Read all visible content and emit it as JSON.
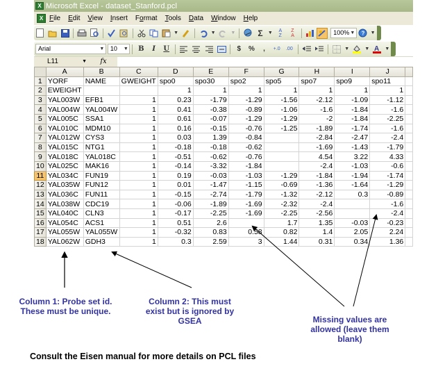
{
  "window": {
    "title": "Microsoft Excel - dataset_Stanford.pcl"
  },
  "menu": {
    "items": [
      "File",
      "Edit",
      "View",
      "Insert",
      "Format",
      "Tools",
      "Data",
      "Window",
      "Help"
    ],
    "mnemonics": [
      "F",
      "E",
      "V",
      "I",
      "o",
      "T",
      "D",
      "W",
      "H"
    ]
  },
  "toolbar": {
    "standard_icons": [
      "new-icon",
      "open-icon",
      "save-icon",
      "print-icon",
      "print-preview-icon",
      "spelling-icon",
      "research-icon",
      "cut-icon",
      "copy-icon",
      "paste-icon",
      "format-painter-icon",
      "undo-icon",
      "redo-icon",
      "hyperlink-icon",
      "autosum-icon",
      "sort-ascending-icon",
      "sort-descending-icon",
      "chart-wizard-icon",
      "drawing-icon",
      "help-icon"
    ],
    "zoom": "100%",
    "font_name": "Arial",
    "font_size": "10",
    "bold_label": "B",
    "italic_label": "I",
    "underline_label": "U",
    "currency_label": "$",
    "percent_label": "%",
    "comma_label": ",",
    "increase_decimal_label": "+.0",
    "decrease_decimal_label": ".00",
    "autosum_label": "Σ",
    "font_color": "#e00000",
    "fill_color": "#ffff00"
  },
  "formula_bar": {
    "name_box": "L11",
    "fx_label": "fx",
    "formula": ""
  },
  "sheet": {
    "columns": [
      "A",
      "B",
      "C",
      "D",
      "E",
      "F",
      "G",
      "H",
      "I",
      "J",
      ""
    ],
    "active_row": 11,
    "rows": [
      {
        "n": "1",
        "cells": [
          "YORF",
          "NAME",
          "GWEIGHT",
          "spo0",
          "spo30",
          "spo2",
          "spo5",
          "spo7",
          "spo9",
          "spo11"
        ]
      },
      {
        "n": "2",
        "cells": [
          "EWEIGHT",
          "",
          "",
          "1",
          "1",
          "1",
          "1",
          "1",
          "1",
          "1"
        ]
      },
      {
        "n": "3",
        "cells": [
          "YAL003W",
          "EFB1",
          "1",
          "0.23",
          "-1.79",
          "-1.29",
          "-1.56",
          "-2.12",
          "-1.09",
          "-1.12"
        ]
      },
      {
        "n": "4",
        "cells": [
          "YAL004W",
          "YAL004W",
          "1",
          "0.41",
          "-0.38",
          "-0.89",
          "-1.06",
          "-1.6",
          "-1.84",
          "-1.6"
        ]
      },
      {
        "n": "5",
        "cells": [
          "YAL005C",
          "SSA1",
          "1",
          "0.61",
          "-0.07",
          "-1.29",
          "-1.29",
          "-2",
          "-1.84",
          "-2.25"
        ]
      },
      {
        "n": "6",
        "cells": [
          "YAL010C",
          "MDM10",
          "1",
          "0.16",
          "-0.15",
          "-0.76",
          "-1.25",
          "-1.89",
          "-1.74",
          "-1.6"
        ]
      },
      {
        "n": "7",
        "cells": [
          "YAL012W",
          "CYS3",
          "1",
          "0.03",
          "1.39",
          "-0.84",
          "",
          "-2.84",
          "-2.47",
          "-2.4"
        ]
      },
      {
        "n": "8",
        "cells": [
          "YAL015C",
          "NTG1",
          "1",
          "-0.18",
          "-0.18",
          "-0.62",
          "",
          "-1.69",
          "-1.43",
          "-1.79"
        ]
      },
      {
        "n": "9",
        "cells": [
          "YAL018C",
          "YAL018C",
          "1",
          "-0.51",
          "-0.62",
          "-0.76",
          "",
          "4.54",
          "3.22",
          "4.33"
        ]
      },
      {
        "n": "10",
        "cells": [
          "YAL025C",
          "MAK16",
          "1",
          "-0.14",
          "-3.32",
          "-1.84",
          "",
          "-2.4",
          "-1.03",
          "-0.6"
        ]
      },
      {
        "n": "11",
        "cells": [
          "YAL034C",
          "FUN19",
          "1",
          "0.19",
          "-0.03",
          "-1.03",
          "-1.29",
          "-1.84",
          "-1.94",
          "-1.74"
        ]
      },
      {
        "n": "12",
        "cells": [
          "YAL035W",
          "FUN12",
          "1",
          "0.01",
          "-1.47",
          "-1.15",
          "-0.69",
          "-1.36",
          "-1.64",
          "-1.29"
        ]
      },
      {
        "n": "13",
        "cells": [
          "YAL036C",
          "FUN11",
          "1",
          "-0.15",
          "-2.74",
          "-1.79",
          "-1.32",
          "-2.12",
          "0.3",
          "-0.89"
        ]
      },
      {
        "n": "14",
        "cells": [
          "YAL038W",
          "CDC19",
          "1",
          "-0.06",
          "-1.89",
          "-1.69",
          "-2.32",
          "-2.4",
          "",
          "-1.6"
        ]
      },
      {
        "n": "15",
        "cells": [
          "YAL040C",
          "CLN3",
          "1",
          "-0.17",
          "-2.25",
          "-1.69",
          "-2.25",
          "-2.56",
          "",
          "-2.4"
        ]
      },
      {
        "n": "16",
        "cells": [
          "YAL054C",
          "ACS1",
          "1",
          "0.51",
          "2.6",
          "",
          "1.7",
          "1.35",
          "-0.03",
          "-0.23"
        ]
      },
      {
        "n": "17",
        "cells": [
          "YAL055W",
          "YAL055W",
          "1",
          "-0.32",
          "0.83",
          "0.58",
          "0.82",
          "1.4",
          "2.05",
          "2.24"
        ]
      },
      {
        "n": "18",
        "cells": [
          "YAL062W",
          "GDH3",
          "1",
          "0.3",
          "2.59",
          "3",
          "1.44",
          "0.31",
          "0.34",
          "1.36"
        ]
      }
    ]
  },
  "annotations": {
    "column1": [
      "Column 1: Probe set id.",
      "These must be unique."
    ],
    "column2": [
      "Column 2: This must",
      "exist but is ignored by",
      "GSEA"
    ],
    "missing": [
      "Missing values are",
      "allowed (leave them",
      "blank)"
    ],
    "footer": "Consult the Eisen manual for more details on PCL files",
    "note_color": "#3333a0"
  }
}
